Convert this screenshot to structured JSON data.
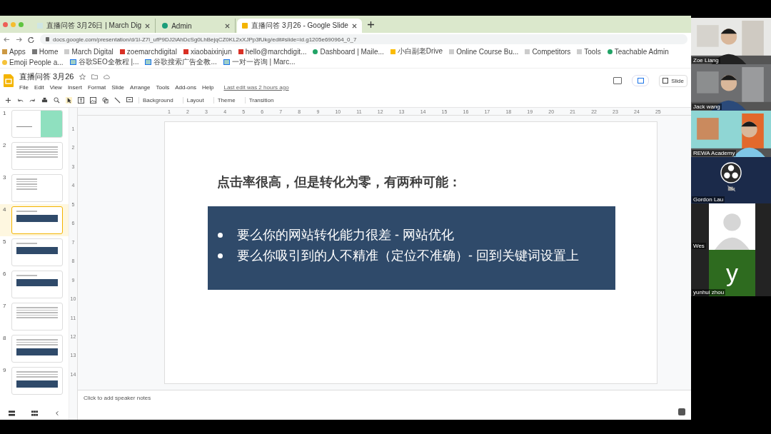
{
  "browser": {
    "tabs": [
      {
        "label": "直播问答 3月26日 | March Dig",
        "selected": false
      },
      {
        "label": "Admin",
        "selected": false
      },
      {
        "label": "直播问答 3月26 - Google Slide",
        "selected": true
      }
    ],
    "url": "docs.google.com/presentation/d/1I-Z7l_ufP9DJ2iAhDcSg0LhBejqCZ0KL2xXJPp3fUkg/edit#slide=id.g1205e690964_0_7",
    "bookmarks": [
      "Apps",
      "Home",
      "March Digital",
      "zoemarchdigital",
      "xiaobaixinjun",
      "hello@marchdigit...",
      "Dashboard | Maile...",
      "小白副老Drive",
      "Online Course Bu...",
      "Competitors",
      "Tools",
      "Teachable Admin",
      "Emoji People a...",
      "谷歌SEO全教程 |...",
      "谷歌搜索广告全教...",
      "一对一咨询 | Marc..."
    ]
  },
  "app": {
    "title": "直播问答 3月26",
    "menu": [
      "File",
      "Edit",
      "View",
      "Insert",
      "Format",
      "Slide",
      "Arrange",
      "Tools",
      "Add-ons",
      "Help"
    ],
    "last_edit": "Last edit was 2 hours ago",
    "slideshow_button": "Slide",
    "toolbar_buttons": [
      "Background",
      "Layout",
      "Theme",
      "Transition"
    ]
  },
  "ruler_marks": [
    "1",
    "2",
    "3",
    "4",
    "5",
    "6",
    "7",
    "8",
    "9",
    "10",
    "11",
    "12",
    "13",
    "14",
    "15",
    "16",
    "17",
    "18",
    "19",
    "20",
    "21",
    "22",
    "23",
    "24",
    "25"
  ],
  "vertical_ruler_marks": [
    "1",
    "2",
    "3",
    "4",
    "5",
    "6",
    "7",
    "8",
    "9",
    "10",
    "11",
    "12",
    "13",
    "14"
  ],
  "thumbnails": [
    {
      "number": "1",
      "kind": "cover",
      "selected": false
    },
    {
      "number": "2",
      "kind": "text",
      "selected": false
    },
    {
      "number": "3",
      "kind": "list",
      "selected": false
    },
    {
      "number": "4",
      "kind": "box",
      "selected": true
    },
    {
      "number": "5",
      "kind": "box",
      "selected": false
    },
    {
      "number": "6",
      "kind": "box",
      "selected": false
    },
    {
      "number": "7",
      "kind": "text",
      "selected": false
    },
    {
      "number": "8",
      "kind": "textbox",
      "selected": false
    },
    {
      "number": "9",
      "kind": "textbox",
      "selected": false
    }
  ],
  "slide": {
    "heading": "点击率很高，但是转化为零，有两种可能：",
    "bullets": [
      "要么你的网站转化能力很差 - 网站优化",
      "要么你吸引到的人不精准（定位不准确）- 回到关键词设置上"
    ]
  },
  "speaker_notes": {
    "placeholder": "Click to add speaker notes"
  },
  "participants": [
    {
      "name": "Zoe Liang",
      "kind": "video"
    },
    {
      "name": "Jack wang",
      "kind": "video"
    },
    {
      "name": "REWA Academy",
      "kind": "video"
    },
    {
      "name": "Gordon Lau",
      "kind": "logo"
    },
    {
      "name": "Wes",
      "kind": "avatar"
    },
    {
      "name": "yunhui zhou",
      "kind": "letter",
      "letter": "y"
    }
  ]
}
